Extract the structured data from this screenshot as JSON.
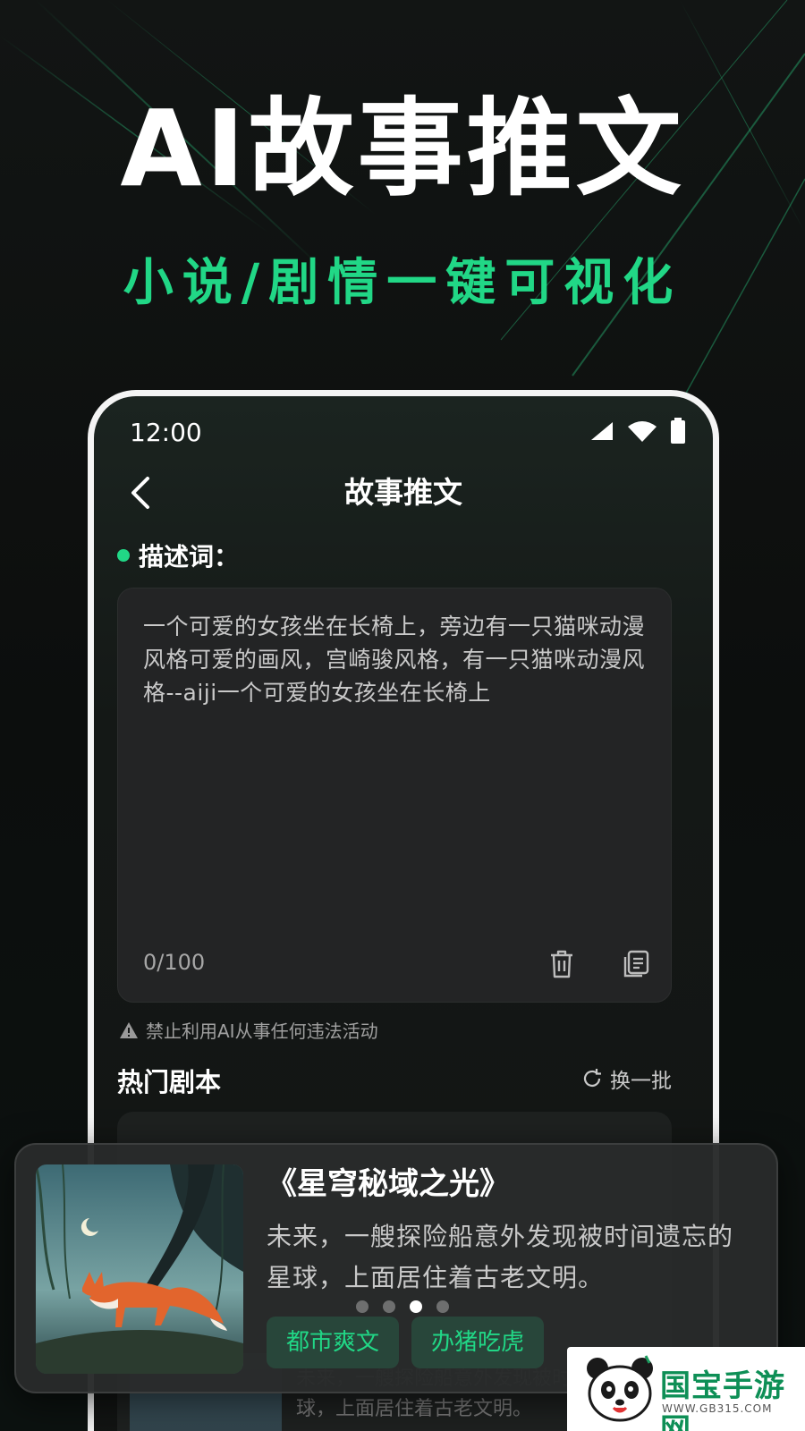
{
  "hero": {
    "title": "AI故事推文",
    "subtitle": "小说/剧情一键可视化"
  },
  "status_bar": {
    "time": "12:00",
    "icons": [
      "signal-icon",
      "wifi-icon",
      "battery-icon"
    ]
  },
  "nav": {
    "back_icon": "chevron-left-icon",
    "title": "故事推文"
  },
  "prompt": {
    "label": "描述词：",
    "text": "一个可爱的女孩坐在长椅上，旁边有一只猫咪动漫风格可爱的画风，宫崎骏风格，有一只猫咪动漫风格--aiji一个可爱的女孩坐在长椅上",
    "char_count": "0/100",
    "actions": [
      "trash-icon",
      "copy-icon"
    ]
  },
  "warning": {
    "icon": "warning-icon",
    "text": "禁止利用AI从事任何违法活动"
  },
  "hot_scripts": {
    "title": "热门剧本",
    "refresh_label": "换一批",
    "ghost_desc": "未来，一艘探险船意外发现被时间遗忘的星球，上面居住着古老文明。"
  },
  "featured_card": {
    "title": "《星穹秘域之光》",
    "description": "未来，一艘探险船意外发现被时间遗忘的星球，上面居住着古老文明。",
    "tags": [
      "都市爽文",
      "办猪吃虎"
    ],
    "carousel_total": 4,
    "carousel_active": 3
  },
  "watermark": {
    "name": "国宝手游网",
    "url": "WWW.GB315.COM"
  },
  "colors": {
    "accent": "#21d786",
    "background": "#0d0f0e",
    "card": "#232425"
  }
}
